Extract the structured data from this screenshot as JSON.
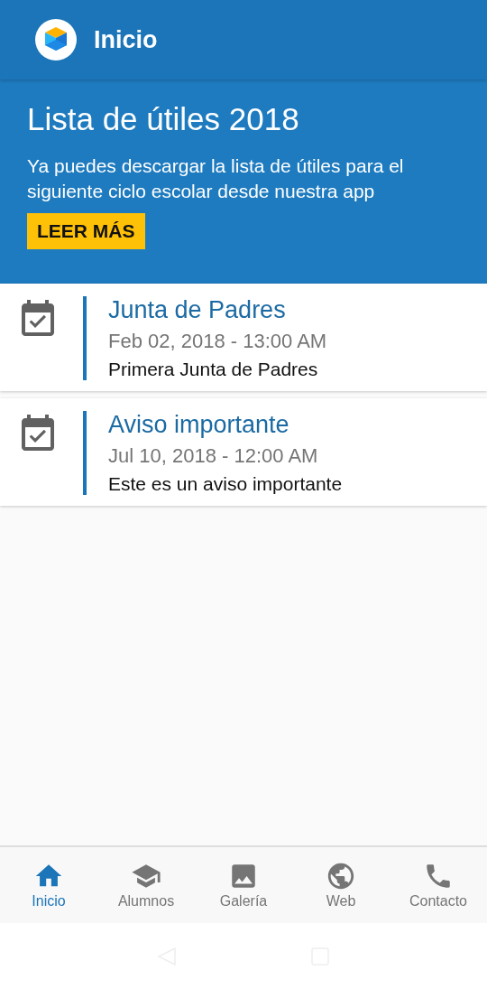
{
  "app_bar": {
    "title": "Inicio"
  },
  "banner": {
    "title": "Lista de útiles 2018",
    "text": "Ya puedes descargar la lista de útiles para el siguiente ciclo escolar desde nuestra app",
    "button": "LEER MÁS"
  },
  "events": [
    {
      "title": "Junta de Padres",
      "date": "Feb 02, 2018 - 13:00 AM",
      "description": "Primera Junta de Padres"
    },
    {
      "title": "Aviso importante",
      "date": "Jul 10, 2018 - 12:00 AM",
      "description": "Este es un aviso importante"
    }
  ],
  "tabs": [
    {
      "label": "Inicio",
      "kind": "home",
      "selected": true
    },
    {
      "label": "Alumnos",
      "kind": "school",
      "selected": false
    },
    {
      "label": "Galería",
      "kind": "image",
      "selected": false
    },
    {
      "label": "Web",
      "kind": "globe",
      "selected": false
    },
    {
      "label": "Contacto",
      "kind": "phone",
      "selected": false
    }
  ]
}
